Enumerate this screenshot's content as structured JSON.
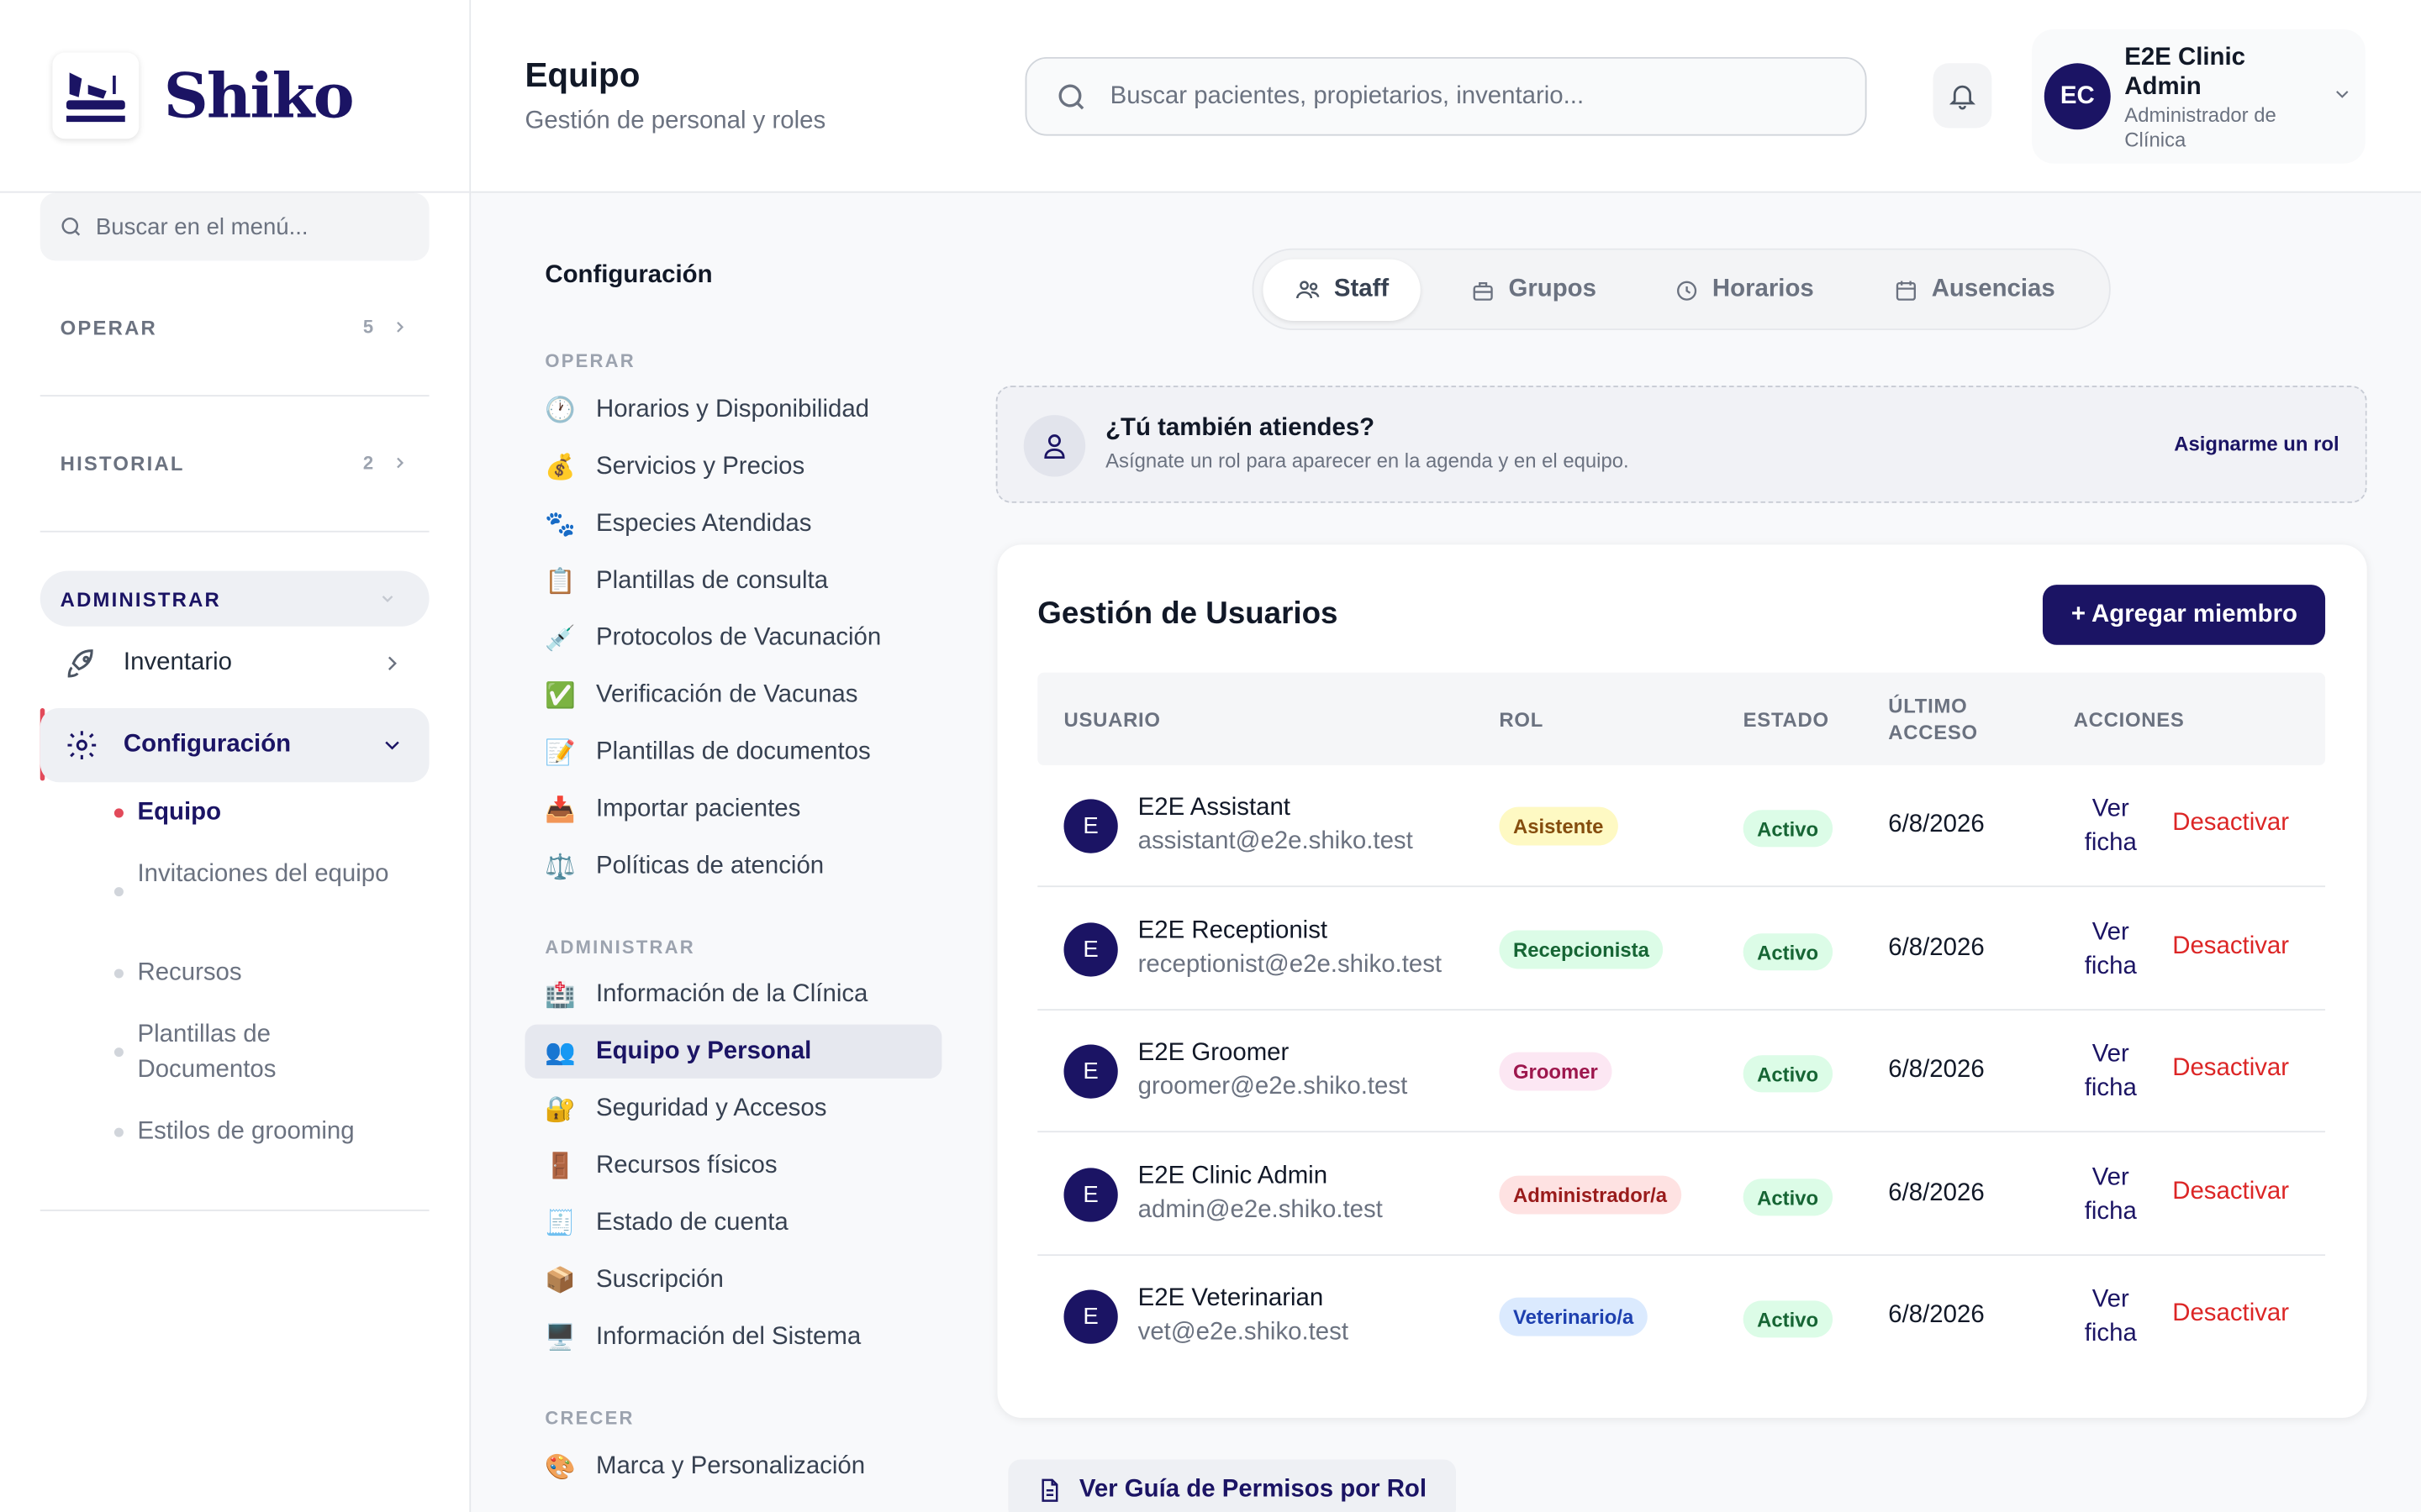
{
  "brand": {
    "name": "Shiko"
  },
  "sidebar": {
    "search_placeholder": "Buscar en el menú...",
    "sections": [
      {
        "label": "OPERAR",
        "count": "5"
      },
      {
        "label": "HISTORIAL",
        "count": "2"
      },
      {
        "label": "ADMINISTRAR"
      }
    ],
    "items": [
      {
        "label": "Inventario"
      },
      {
        "label": "Configuración"
      }
    ],
    "subitems": [
      {
        "label": "Equipo"
      },
      {
        "label": "Invitaciones del equipo"
      },
      {
        "label": "Recursos"
      },
      {
        "label": "Plantillas de Documentos"
      },
      {
        "label": "Estilos de grooming"
      }
    ]
  },
  "header": {
    "title": "Equipo",
    "subtitle": "Gestión de personal y roles",
    "search_placeholder": "Buscar pacientes, propietarios, inventario...",
    "user": {
      "initials": "EC",
      "name": "E2E Clinic Admin",
      "role": "Administrador de Clínica"
    }
  },
  "config_menu": {
    "title": "Configuración",
    "sections": [
      {
        "label": "OPERAR",
        "items": [
          {
            "icon": "🕐",
            "label": "Horarios y Disponibilidad"
          },
          {
            "icon": "💰",
            "label": "Servicios y Precios"
          },
          {
            "icon": "🐾",
            "label": "Especies Atendidas"
          },
          {
            "icon": "📋",
            "label": "Plantillas de consulta"
          },
          {
            "icon": "💉",
            "label": "Protocolos de Vacunación"
          },
          {
            "icon": "✅",
            "label": "Verificación de Vacunas"
          },
          {
            "icon": "📝",
            "label": "Plantillas de documentos"
          },
          {
            "icon": "📥",
            "label": "Importar pacientes"
          },
          {
            "icon": "⚖️",
            "label": "Políticas de atención"
          }
        ]
      },
      {
        "label": "ADMINISTRAR",
        "items": [
          {
            "icon": "🏥",
            "label": "Información de la Clínica"
          },
          {
            "icon": "👥",
            "label": "Equipo y Personal"
          },
          {
            "icon": "🔐",
            "label": "Seguridad y Accesos"
          },
          {
            "icon": "🚪",
            "label": "Recursos físicos"
          },
          {
            "icon": "🧾",
            "label": "Estado de cuenta"
          },
          {
            "icon": "📦",
            "label": "Suscripción"
          },
          {
            "icon": "🖥️",
            "label": "Información del Sistema"
          }
        ]
      },
      {
        "label": "CRECER",
        "items": [
          {
            "icon": "🎨",
            "label": "Marca y Personalización"
          }
        ]
      }
    ]
  },
  "tabs": [
    {
      "label": "Staff"
    },
    {
      "label": "Grupos"
    },
    {
      "label": "Horarios"
    },
    {
      "label": "Ausencias"
    }
  ],
  "notice": {
    "title": "¿Tú también atiendes?",
    "text": "Asígnate un rol para aparecer en la agenda y en el equipo.",
    "action": "Asignarme un rol"
  },
  "users_card": {
    "title": "Gestión de Usuarios",
    "add_label": "+ Agregar miembro",
    "columns": [
      "USUARIO",
      "ROL",
      "ESTADO",
      "ÚLTIMO ACCESO",
      "ACCIONES"
    ],
    "rows": [
      {
        "initial": "E",
        "name": "E2E Assistant",
        "email": "assistant@e2e.shiko.test",
        "role": "Asistente",
        "status": "Activo",
        "last_access": "6/8/2026",
        "view": "Ver ficha",
        "deactivate": "Desactivar"
      },
      {
        "initial": "E",
        "name": "E2E Receptionist",
        "email": "receptionist@e2e.shiko.test",
        "role": "Recepcionista",
        "status": "Activo",
        "last_access": "6/8/2026",
        "view": "Ver ficha",
        "deactivate": "Desactivar"
      },
      {
        "initial": "E",
        "name": "E2E Groomer",
        "email": "groomer@e2e.shiko.test",
        "role": "Groomer",
        "status": "Activo",
        "last_access": "6/8/2026",
        "view": "Ver ficha",
        "deactivate": "Desactivar"
      },
      {
        "initial": "E",
        "name": "E2E Clinic Admin",
        "email": "admin@e2e.shiko.test",
        "role": "Administrador/a",
        "status": "Activo",
        "last_access": "6/8/2026",
        "view": "Ver ficha",
        "deactivate": "Desactivar"
      },
      {
        "initial": "E",
        "name": "E2E Veterinarian",
        "email": "vet@e2e.shiko.test",
        "role": "Veterinario/a",
        "status": "Activo",
        "last_access": "6/8/2026",
        "view": "Ver ficha",
        "deactivate": "Desactivar"
      }
    ]
  },
  "guide_label": "Ver Guía de Permisos por Rol",
  "colors": {
    "brand": "#1b1464",
    "accent_red": "#e24a5a",
    "danger": "#dc2626",
    "status_green_bg": "#dcfce7"
  }
}
